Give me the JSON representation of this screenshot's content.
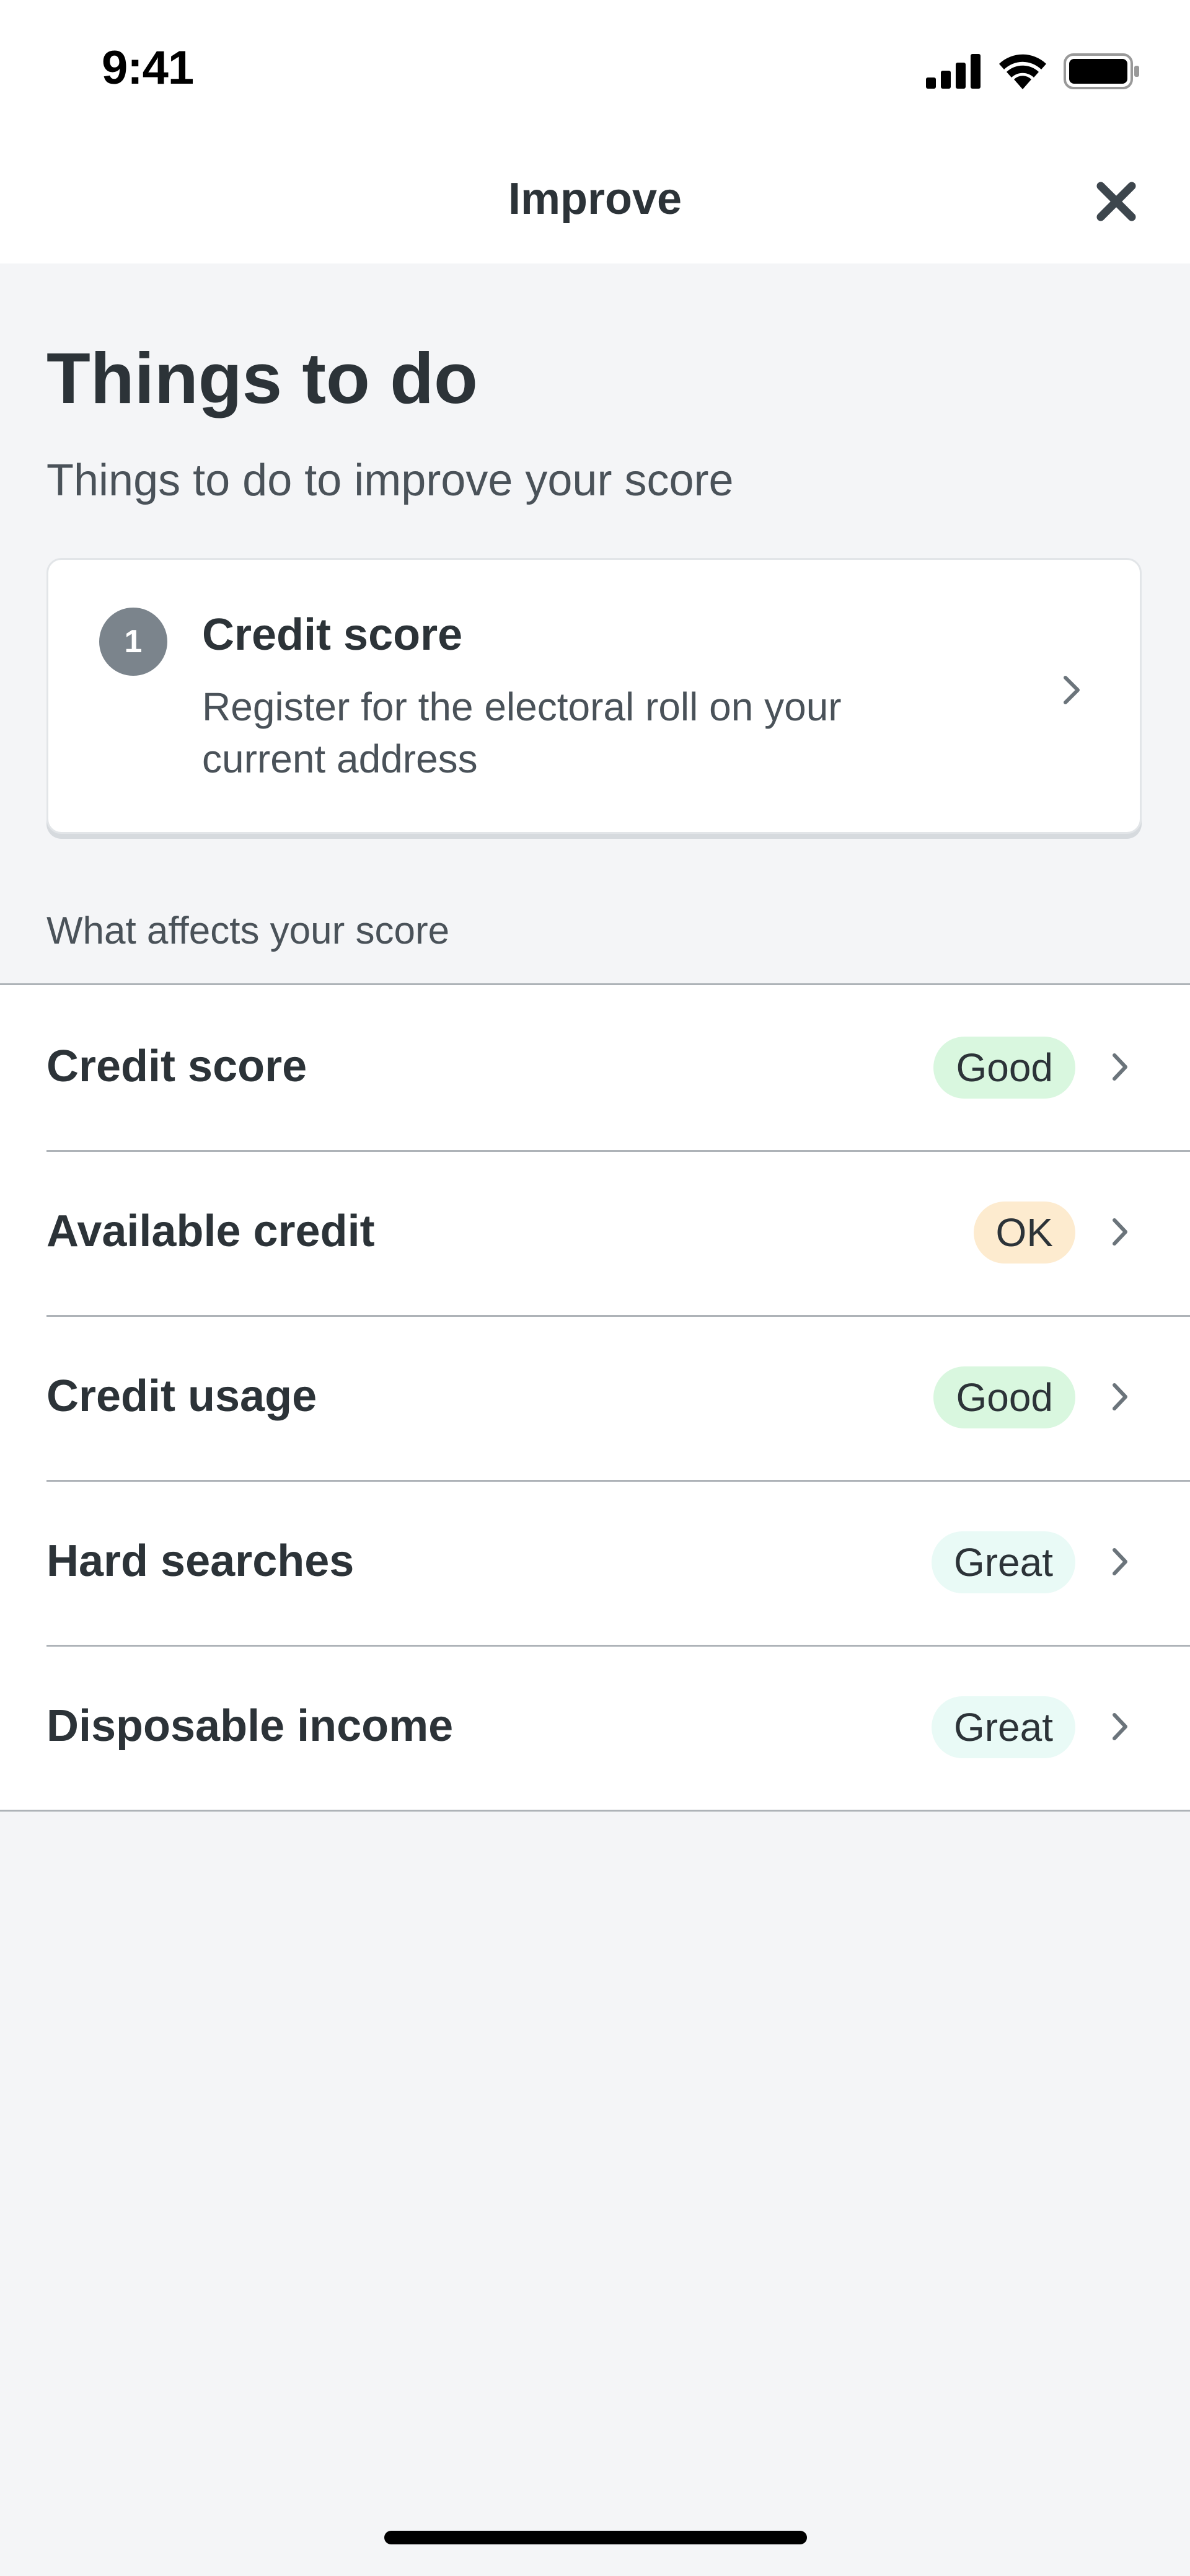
{
  "status_bar": {
    "time": "9:41",
    "icons": [
      "cellular-signal-icon",
      "wifi-icon",
      "battery-icon"
    ]
  },
  "nav": {
    "title": "Improve",
    "close_icon": "close-icon"
  },
  "header": {
    "title": "Things to do",
    "subtitle": "Things to do to improve your score"
  },
  "todo": {
    "number": "1",
    "title": "Credit score",
    "description": "Register for the electoral roll on your current address"
  },
  "factors": {
    "section_label": "What affects your score",
    "items": [
      {
        "label": "Credit score",
        "rating": "Good",
        "rating_color": "#d9f7df"
      },
      {
        "label": "Available credit",
        "rating": "OK",
        "rating_color": "#fdebcf"
      },
      {
        "label": "Credit usage",
        "rating": "Good",
        "rating_color": "#d9f7df"
      },
      {
        "label": "Hard searches",
        "rating": "Great",
        "rating_color": "#e9faf6"
      },
      {
        "label": "Disposable income",
        "rating": "Great",
        "rating_color": "#e9faf6"
      }
    ]
  }
}
